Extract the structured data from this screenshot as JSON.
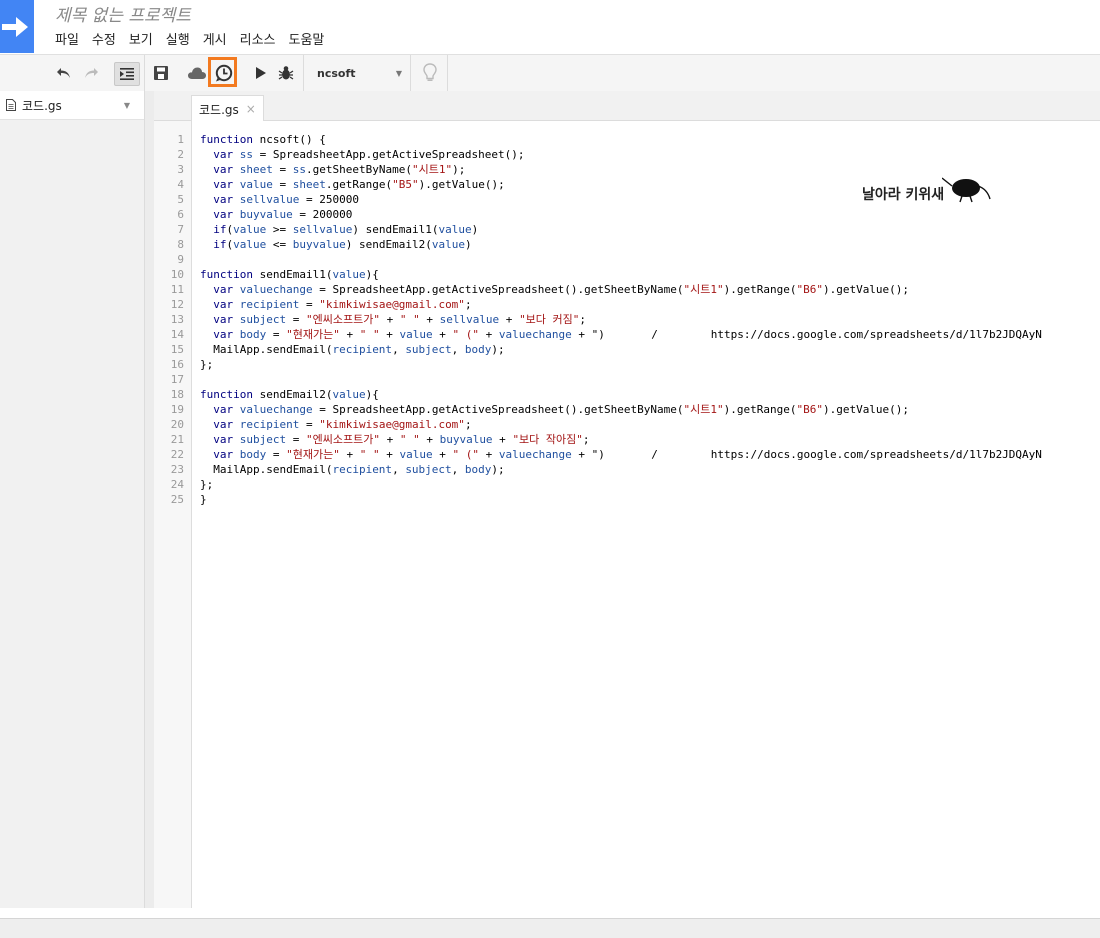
{
  "app": {
    "title": "제목 없는 프로젝트",
    "accent": "#4285f4"
  },
  "menu": [
    "파일",
    "수정",
    "보기",
    "실행",
    "게시",
    "리소스",
    "도움말"
  ],
  "toolbar": {
    "function_select": "ncsoft",
    "highlight_color": "#f37a20",
    "icons": [
      "undo-icon",
      "redo-icon",
      "indent-icon",
      "save-icon",
      "cloud-publish-icon",
      "trigger-clock-icon",
      "run-icon",
      "debug-icon",
      "lightbulb-icon"
    ]
  },
  "sidebar": {
    "file_name": "코드.gs"
  },
  "editor": {
    "tab_label": "코드.gs",
    "tab_close": "×",
    "watermark": "날아라 키위새",
    "line_numbers": [
      "1",
      "2",
      "3",
      "4",
      "5",
      "6",
      "7",
      "8",
      "9",
      "10",
      "11",
      "12",
      "13",
      "14",
      "15",
      "16",
      "17",
      "18",
      "19",
      "20",
      "21",
      "22",
      "23",
      "24",
      "25"
    ],
    "code": [
      "function ncsoft() {",
      "  var ss = SpreadsheetApp.getActiveSpreadsheet();",
      "  var sheet = ss.getSheetByName(\"시트1\");",
      "  var value = sheet.getRange(\"B5\").getValue();",
      "  var sellvalue = 250000",
      "  var buyvalue = 200000",
      "  if(value >= sellvalue) sendEmail1(value)",
      "  if(value <= buyvalue) sendEmail2(value)",
      "",
      "function sendEmail1(value){",
      "  var valuechange = SpreadsheetApp.getActiveSpreadsheet().getSheetByName(\"시트1\").getRange(\"B6\").getValue();",
      "  var recipient = \"kimkiwisae@gmail.com\";",
      "  var subject = \"엔씨소프트가\" + \" \" + sellvalue + \"보다 커짐\";",
      "  var body = \"현재가는\" + \" \" + value + \" (\" + valuechange + \")       /        https://docs.google.com/spreadsheets/d/1l7b2JDQAyN",
      "  MailApp.sendEmail(recipient, subject, body);",
      "};",
      "",
      "function sendEmail2(value){",
      "  var valuechange = SpreadsheetApp.getActiveSpreadsheet().getSheetByName(\"시트1\").getRange(\"B6\").getValue();",
      "  var recipient = \"kimkiwisae@gmail.com\";",
      "  var subject = \"엔씨소프트가\" + \" \" + buyvalue + \"보다 작아짐\";",
      "  var body = \"현재가는\" + \" \" + value + \" (\" + valuechange + \")       /        https://docs.google.com/spreadsheets/d/1l7b2JDQAyN",
      "  MailApp.sendEmail(recipient, subject, body);",
      "};",
      "}"
    ]
  }
}
